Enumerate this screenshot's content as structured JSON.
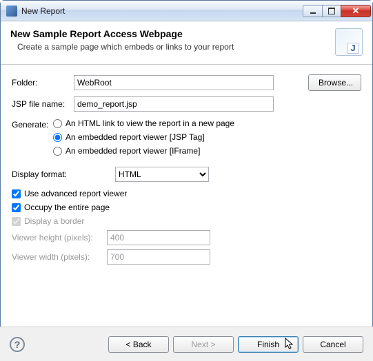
{
  "window": {
    "title": "New Report"
  },
  "header": {
    "title": "New Sample Report Access Webpage",
    "subtitle": "Create a sample page which embeds or links to your report"
  },
  "form": {
    "folder_label": "Folder:",
    "folder_value": "WebRoot",
    "browse_label": "Browse...",
    "jsp_label": "JSP file name:",
    "jsp_value": "demo_report.jsp"
  },
  "generate": {
    "label": "Generate:",
    "options": [
      "An HTML link to view the report in a new page",
      "An embedded report viewer [JSP Tag]",
      "An embedded report viewer [IFrame]"
    ],
    "selected_index": 1
  },
  "display": {
    "label": "Display format:",
    "value": "HTML"
  },
  "checks": {
    "advanced": {
      "label": "Use advanced report viewer",
      "checked": true,
      "enabled": true
    },
    "occupy": {
      "label": "Occupy the entire page",
      "checked": true,
      "enabled": true
    },
    "border": {
      "label": "Display a border",
      "checked": true,
      "enabled": false
    }
  },
  "dims": {
    "height_label": "Viewer height (pixels):",
    "height_value": "400",
    "width_label": "Viewer width (pixels):",
    "width_value": "700"
  },
  "footer": {
    "back": "< Back",
    "next": "Next >",
    "finish": "Finish",
    "cancel": "Cancel"
  }
}
